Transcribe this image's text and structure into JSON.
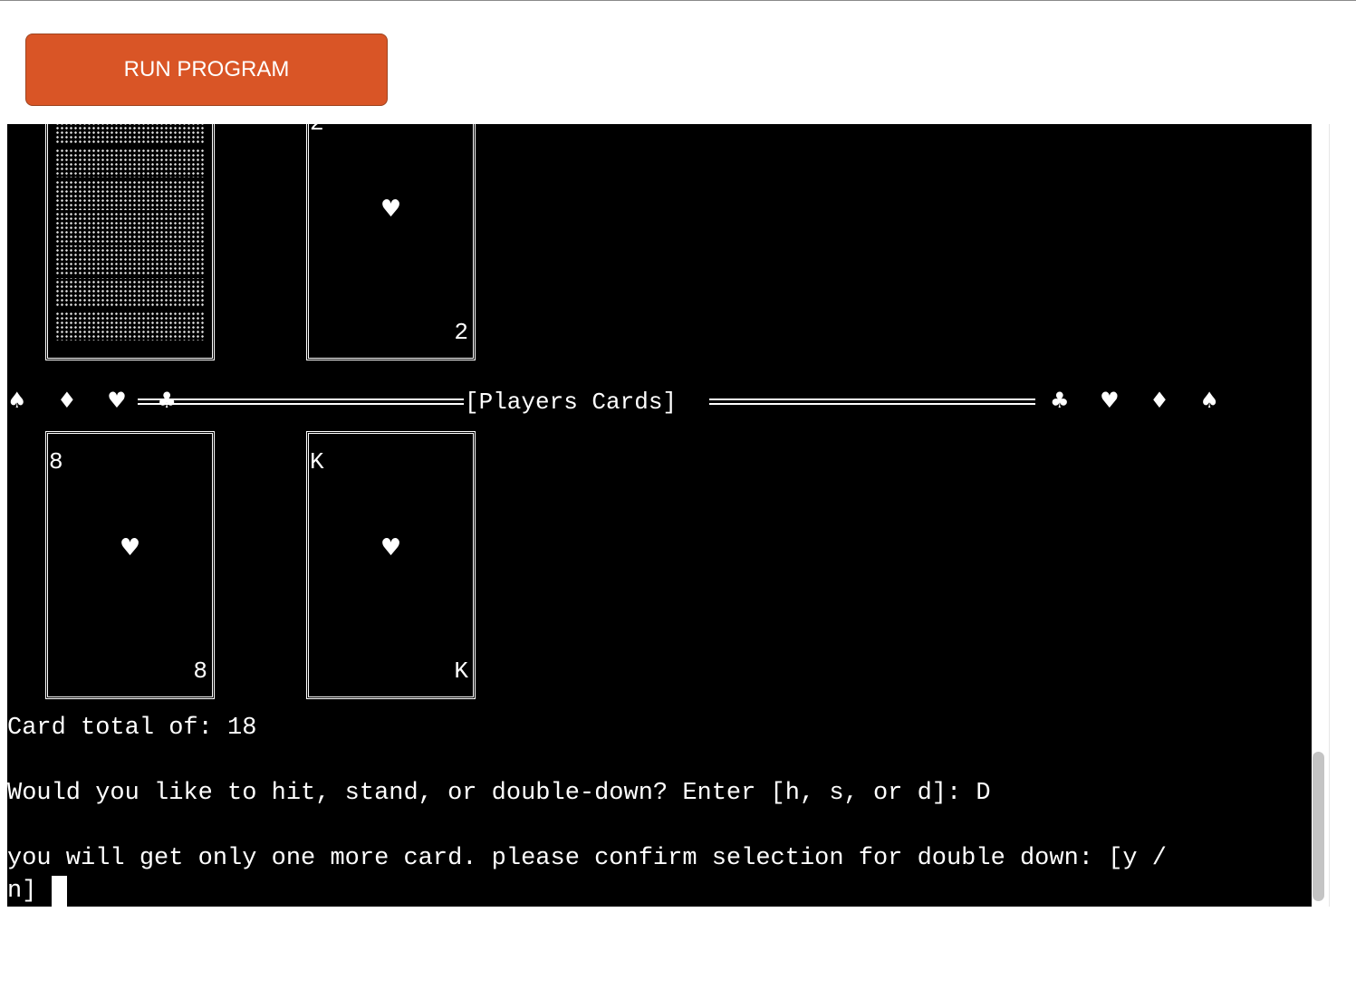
{
  "toolbar": {
    "run_label": "RUN PROGRAM"
  },
  "terminal": {
    "dealer_cards": [
      {
        "face": "down"
      },
      {
        "rank": "2",
        "suit": "♥"
      }
    ],
    "divider": {
      "left_suits": "♠ ♦ ♥ ♣",
      "label": "[Players Cards]",
      "right_suits": "♣ ♥ ♦ ♠"
    },
    "player_cards": [
      {
        "rank": "8",
        "suit": "♥"
      },
      {
        "rank": "K",
        "suit": "♥"
      }
    ],
    "lines": {
      "total": "Card total of: 18",
      "prompt": "Would you like to hit, stand, or double-down? Enter [h, s, or d]: D",
      "confirm_1": "you will get only one more card. please confirm selection for double down: [y /",
      "confirm_2": "n]"
    }
  },
  "colors": {
    "button": "#d95526",
    "terminal_bg": "#000000",
    "terminal_fg": "#ffffff"
  }
}
